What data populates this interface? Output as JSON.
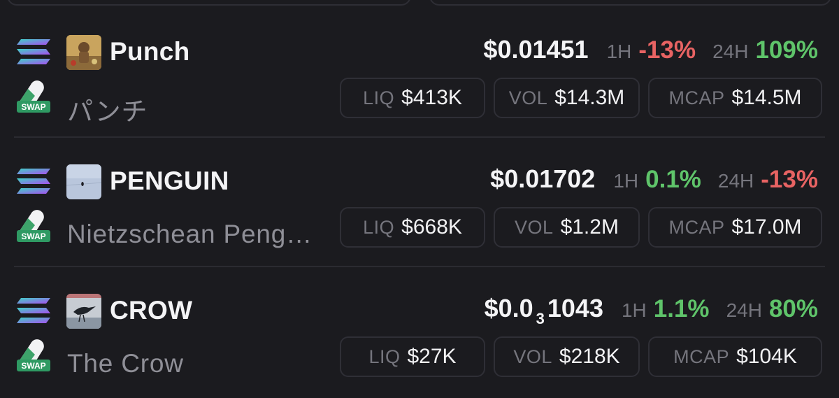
{
  "colors": {
    "background": "#1b1b1f",
    "positive": "#5fc46a",
    "negative": "#e86363",
    "muted": "#75757d",
    "border": "#2f2f36"
  },
  "labels": {
    "h1": "1H",
    "h24": "24H",
    "liq": "LIQ",
    "vol": "VOL",
    "mcap": "MCAP",
    "swap": "SWAP"
  },
  "tokens": [
    {
      "symbol": "Punch",
      "name": "パンチ",
      "price": "$0.01451",
      "change_1h": "-13%",
      "change_1h_trend": "negative",
      "change_24h": "109%",
      "change_24h_trend": "positive",
      "liq": "$413K",
      "vol": "$14.3M",
      "mcap": "$14.5M",
      "chain_icon": "solana-icon",
      "swap_icon": "swap-icon",
      "avatar": "punch-token-avatar"
    },
    {
      "symbol": "PENGUIN",
      "name": "Nietzschean Peng…",
      "price": "$0.01702",
      "change_1h": "0.1%",
      "change_1h_trend": "positive",
      "change_24h": "-13%",
      "change_24h_trend": "negative",
      "liq": "$668K",
      "vol": "$1.2M",
      "mcap": "$17.0M",
      "chain_icon": "solana-icon",
      "swap_icon": "swap-icon",
      "avatar": "penguin-token-avatar"
    },
    {
      "symbol": "CROW",
      "name": "The Crow",
      "price_prefix": "$0.0",
      "price_zeros": "3",
      "price_digits": "1043",
      "change_1h": "1.1%",
      "change_1h_trend": "positive",
      "change_24h": "80%",
      "change_24h_trend": "positive",
      "liq": "$27K",
      "vol": "$218K",
      "mcap": "$104K",
      "chain_icon": "solana-icon",
      "swap_icon": "swap-icon",
      "avatar": "crow-token-avatar"
    }
  ]
}
